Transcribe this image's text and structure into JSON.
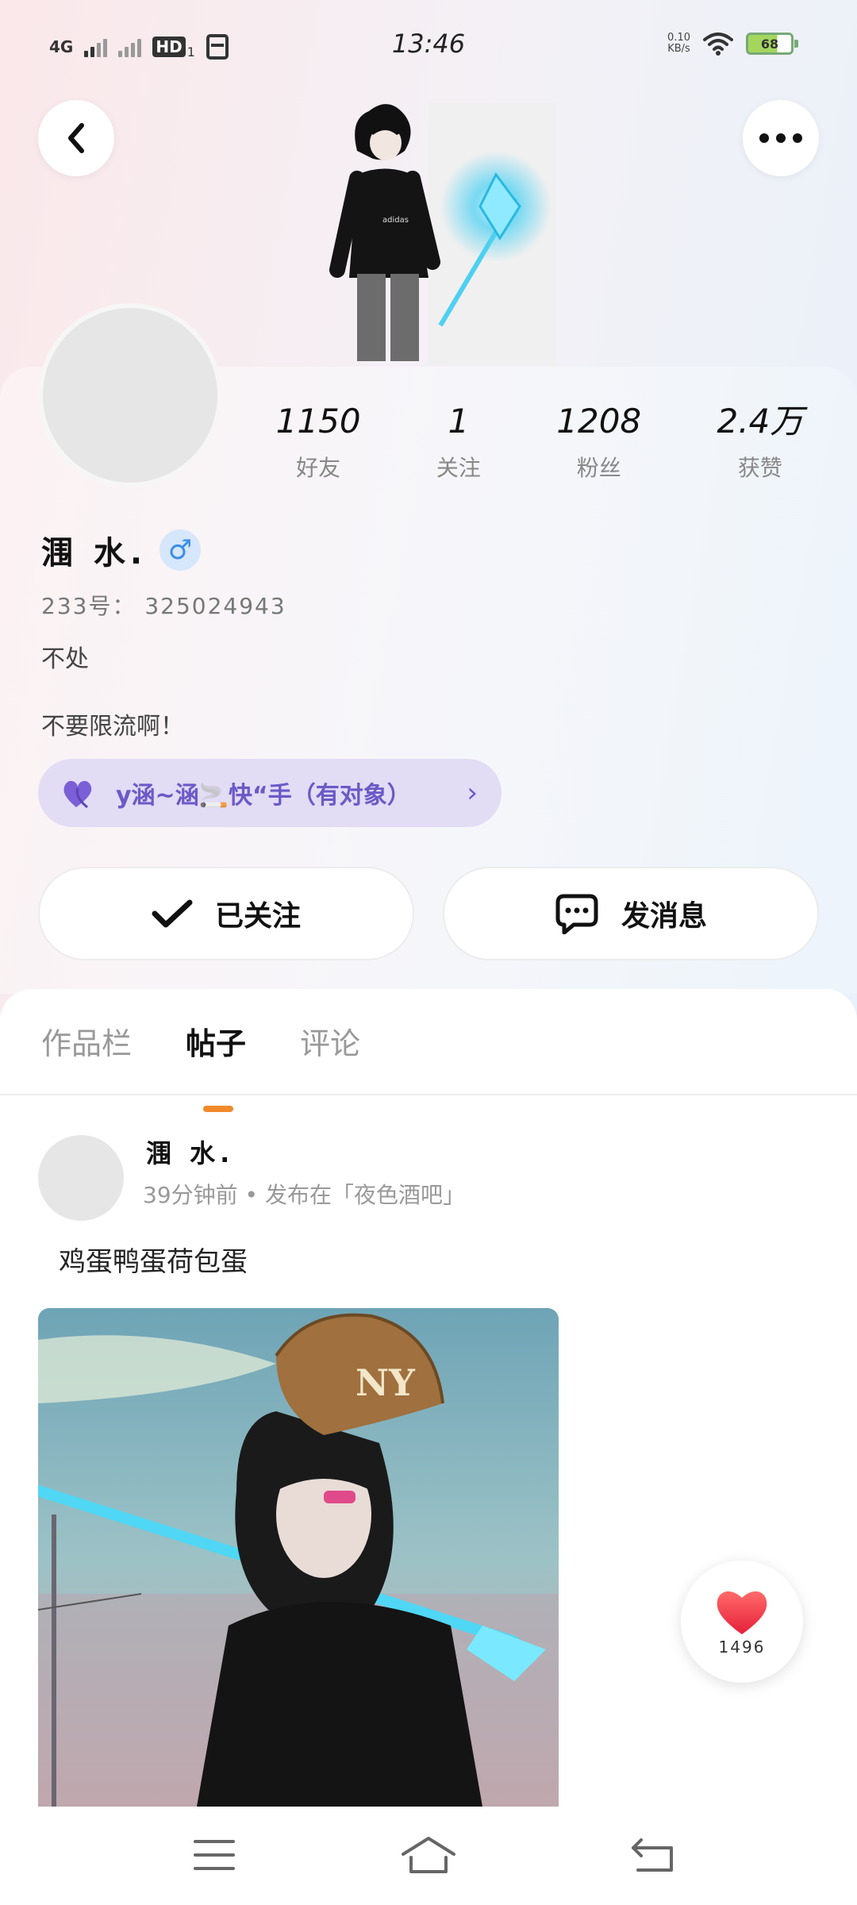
{
  "status_bar": {
    "network": "4G",
    "hd_label": "HD",
    "hd_sub": "1",
    "time": "13:46",
    "net_speed": "0.10",
    "net_unit": "KB/s",
    "battery": "68"
  },
  "profile": {
    "stats": [
      {
        "value": "1150",
        "label": "好友"
      },
      {
        "value": "1",
        "label": "关注"
      },
      {
        "value": "1208",
        "label": "粉丝"
      },
      {
        "value": "2.4万",
        "label": "获赞"
      }
    ],
    "name": "涠 水.",
    "gender_symbol": "♂",
    "uid": "233号： 325024943",
    "signature": "不处",
    "bio": "不要限流啊！",
    "cp_text": "y涵~涵🚬快“手（有对象）",
    "followed_label": "已关注",
    "message_label": "发消息"
  },
  "tabs": [
    {
      "label": "作品栏",
      "active": false
    },
    {
      "label": "帖子",
      "active": true
    },
    {
      "label": "评论",
      "active": false
    }
  ],
  "post": {
    "author": "涠 水.",
    "meta": "39分钟前 • 发布在「夜色酒吧」",
    "text": "鸡蛋鸭蛋荷包蛋",
    "cap_logo": "NY"
  },
  "like": {
    "count": "1496"
  },
  "icons": {
    "back": "chevron-left-icon",
    "more": "more-dots-icon",
    "followed": "check-icon",
    "message": "chat-bubble-icon",
    "cp": "purple-heart-icon",
    "like": "red-heart-icon"
  },
  "colors": {
    "accent_tab": "#f28a2c",
    "cp_purple": "#6b5ac7",
    "gender_blue": "#3a8ee6",
    "like_red": "#f2404a"
  }
}
